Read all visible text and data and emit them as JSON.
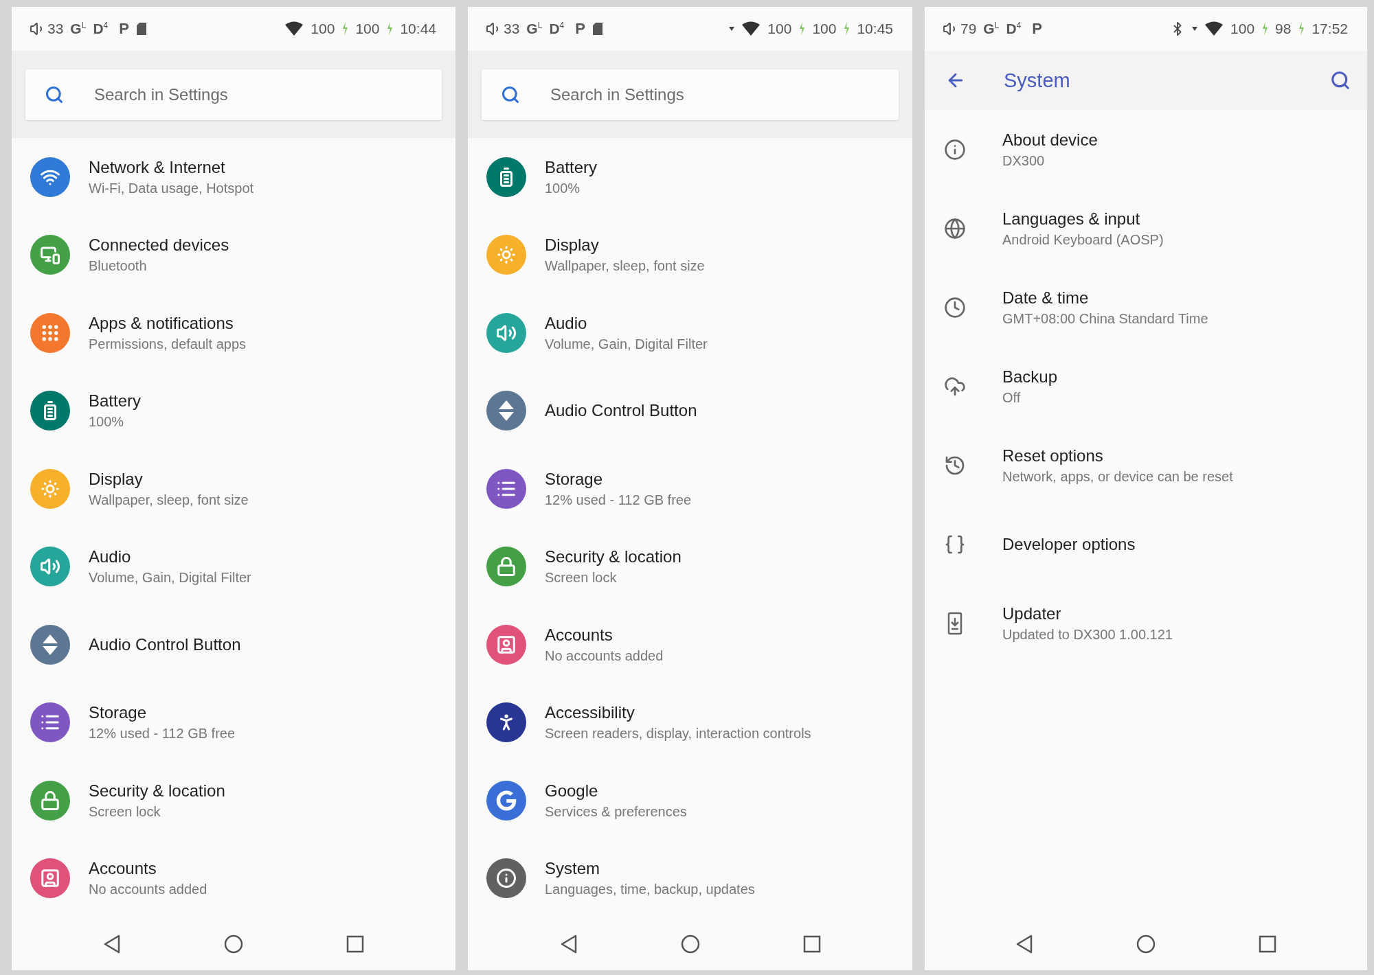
{
  "panels": [
    {
      "status_bar": {
        "volume": "33",
        "indicators": [
          {
            "letter": "G",
            "sup": "L"
          },
          {
            "letter": "D",
            "sup": "4"
          }
        ],
        "badge": "P",
        "left_icons": [
          {
            "kind": "sd-card"
          }
        ],
        "right_icons": [
          {
            "kind": "wifi"
          }
        ],
        "readings": [
          "100",
          "100"
        ],
        "time": "10:44"
      },
      "header": {
        "kind": "search",
        "placeholder": "Search in Settings"
      },
      "items": [
        {
          "title": "Network & Internet",
          "subtitle": "Wi-Fi, Data usage, Hotspot",
          "kind": "network",
          "color": "#2f7ad6"
        },
        {
          "title": "Connected devices",
          "subtitle": "Bluetooth",
          "kind": "devices",
          "color": "#43a047"
        },
        {
          "title": "Apps & notifications",
          "subtitle": "Permissions, default apps",
          "kind": "apps",
          "color": "#f4772e"
        },
        {
          "title": "Battery",
          "subtitle": "100%",
          "kind": "battery",
          "color": "#00796b"
        },
        {
          "title": "Display",
          "subtitle": "Wallpaper, sleep, font size",
          "kind": "display",
          "color": "#f6b02a"
        },
        {
          "title": "Audio",
          "subtitle": "Volume, Gain, Digital Filter",
          "kind": "audio",
          "color": "#26a69a"
        },
        {
          "title": "Audio Control Button",
          "kind": "audio-control",
          "color": "#5c7693"
        },
        {
          "title": "Storage",
          "subtitle": "12% used - 112 GB free",
          "kind": "storage",
          "color": "#7e57c2"
        },
        {
          "title": "Security & location",
          "subtitle": "Screen lock",
          "kind": "security",
          "color": "#43a047"
        },
        {
          "title": "Accounts",
          "subtitle": "No accounts added",
          "kind": "accounts",
          "color": "#e0527a"
        }
      ]
    },
    {
      "status_bar": {
        "volume": "33",
        "indicators": [
          {
            "letter": "G",
            "sup": "L"
          },
          {
            "letter": "D",
            "sup": "4"
          }
        ],
        "badge": "P",
        "left_icons": [
          {
            "kind": "sd-card"
          }
        ],
        "right_icons": [
          {
            "kind": "data-arrow"
          },
          {
            "kind": "wifi"
          }
        ],
        "readings": [
          "100",
          "100"
        ],
        "time": "10:45"
      },
      "header": {
        "kind": "search",
        "placeholder": "Search in Settings"
      },
      "items": [
        {
          "title": "Battery",
          "subtitle": "100%",
          "kind": "battery",
          "color": "#00796b"
        },
        {
          "title": "Display",
          "subtitle": "Wallpaper, sleep, font size",
          "kind": "display",
          "color": "#f6b02a"
        },
        {
          "title": "Audio",
          "subtitle": "Volume, Gain, Digital Filter",
          "kind": "audio",
          "color": "#26a69a"
        },
        {
          "title": "Audio Control Button",
          "kind": "audio-control",
          "color": "#5c7693"
        },
        {
          "title": "Storage",
          "subtitle": "12% used - 112 GB free",
          "kind": "storage",
          "color": "#7e57c2"
        },
        {
          "title": "Security & location",
          "subtitle": "Screen lock",
          "kind": "security",
          "color": "#43a047"
        },
        {
          "title": "Accounts",
          "subtitle": "No accounts added",
          "kind": "accounts",
          "color": "#e0527a"
        },
        {
          "title": "Accessibility",
          "subtitle": "Screen readers, display, interaction controls",
          "kind": "accessibility",
          "color": "#283593"
        },
        {
          "title": "Google",
          "subtitle": "Services & preferences",
          "kind": "google",
          "color": "#3b6fd8"
        },
        {
          "title": "System",
          "subtitle": "Languages, time, backup, updates",
          "kind": "system",
          "color": "#616161"
        }
      ]
    },
    {
      "status_bar": {
        "volume": "79",
        "indicators": [
          {
            "letter": "G",
            "sup": "L"
          },
          {
            "letter": "D",
            "sup": "4"
          }
        ],
        "badge": "P",
        "right_icons": [
          {
            "kind": "bluetooth"
          },
          {
            "kind": "data-arrow"
          },
          {
            "kind": "wifi"
          }
        ],
        "readings": [
          "100",
          "98"
        ],
        "time": "17:52"
      },
      "header": {
        "kind": "toolbar",
        "title": "System"
      },
      "items": [
        {
          "title": "About device",
          "subtitle": "DX300",
          "kind": "about"
        },
        {
          "title": "Languages & input",
          "subtitle": "Android Keyboard (AOSP)",
          "kind": "languages"
        },
        {
          "title": "Date & time",
          "subtitle": "GMT+08:00 China Standard Time",
          "kind": "datetime"
        },
        {
          "title": "Backup",
          "subtitle": "Off",
          "kind": "backup"
        },
        {
          "title": "Reset options",
          "subtitle": "Network, apps, or device can be reset",
          "kind": "reset"
        },
        {
          "title": "Developer options",
          "kind": "developer"
        },
        {
          "title": "Updater",
          "subtitle": "Updated to DX300 1.00.121",
          "kind": "updater"
        }
      ]
    }
  ]
}
